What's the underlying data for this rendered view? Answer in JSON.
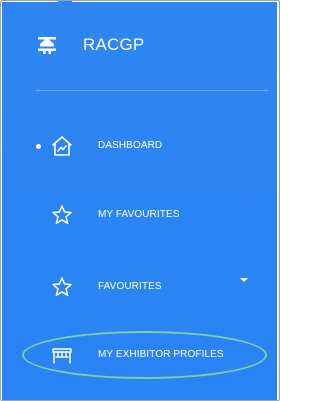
{
  "brand": {
    "title": "RACGP",
    "logo_icon": "racgp-logo-icon"
  },
  "nav": {
    "items": [
      {
        "label": "DASHBOARD",
        "icon": "dashboard-house-icon",
        "active": true
      },
      {
        "label": "MY FAVOURITES",
        "icon": "star-icon"
      },
      {
        "label": "FAVOURITES",
        "icon": "star-icon",
        "has_dropdown": true
      },
      {
        "label": "MY EXHIBITOR PROFILES",
        "icon": "exhibitor-booth-icon",
        "highlighted": true
      }
    ]
  },
  "colors": {
    "sidebar": "#2b84f3",
    "text": "#ffffff",
    "highlight": "#7ad09d"
  }
}
